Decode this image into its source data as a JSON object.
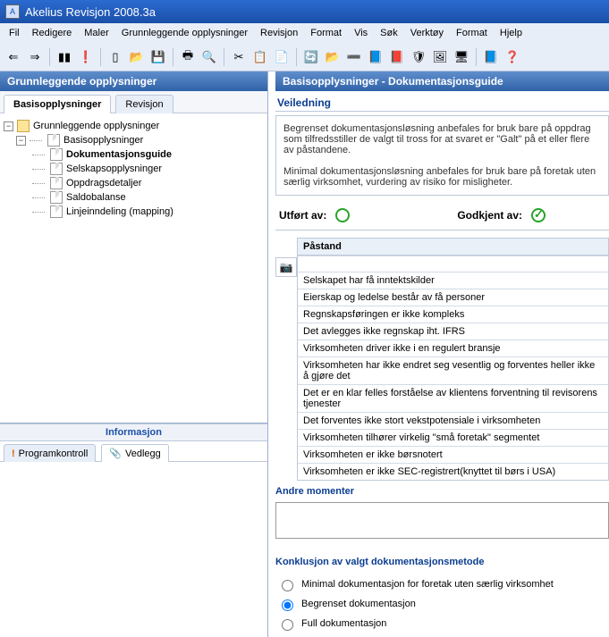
{
  "window": {
    "title": "Akelius Revisjon 2008.3a"
  },
  "menu": [
    "Fil",
    "Redigere",
    "Maler",
    "Grunnleggende opplysninger",
    "Revisjon",
    "Format",
    "Vis",
    "Søk",
    "Verktøy",
    "Format",
    "Hjelp"
  ],
  "toolbar_icons": [
    "⇐",
    "⇒",
    "▮▮",
    "❗",
    "▯",
    "📂",
    "💾",
    "🖶",
    "🔍",
    "✂",
    "📋",
    "📄",
    "🔄",
    "📂",
    "➖",
    "📘",
    "📕",
    "🛡",
    "🖼",
    "🖥",
    "📘",
    "❓"
  ],
  "left": {
    "panel_title": "Grunnleggende opplysninger",
    "tabs": [
      {
        "label": "Basisopplysninger",
        "active": true
      },
      {
        "label": "Revisjon",
        "active": false
      }
    ],
    "tree": {
      "root": "Grunnleggende opplysninger",
      "child": "Basisopplysninger",
      "items": [
        {
          "label": "Dokumentasjonsguide",
          "selected": true
        },
        {
          "label": "Selskapsopplysninger"
        },
        {
          "label": "Oppdragsdetaljer"
        },
        {
          "label": "Saldobalanse"
        },
        {
          "label": "Linjeinndeling (mapping)"
        }
      ]
    },
    "info_title": "Informasjon",
    "info_tabs": [
      {
        "label": "Programkontroll",
        "icon": "!",
        "active": false
      },
      {
        "label": "Vedlegg",
        "icon": "📎",
        "active": true
      }
    ]
  },
  "right": {
    "header": "Basisopplysninger - Dokumentasjonsguide",
    "veiledning_title": "Veiledning",
    "help_p1": "Begrenset dokumentasjonsløsning anbefales for bruk bare på oppdrag som tilfredsstiller de valgt til tross for at svaret er \"Galt\" på et eller flere av påstandene.",
    "help_p2": "Minimal dokumentasjonsløsning anbefales for bruk bare på foretak uten særlig virksomhet, vurdering av risiko for misligheter.",
    "utfort_label": "Utført av:",
    "godkjent_label": "Godkjent av:",
    "pastand_header": "Påstand",
    "pastand_rows": [
      "Selskapet har få inntektskilder",
      "Eierskap og ledelse består av få personer",
      "Regnskapsføringen er ikke kompleks",
      "Det avlegges ikke regnskap iht. IFRS",
      "Virksomheten driver ikke i en regulert bransje",
      "Virksomheten har ikke endret seg vesentlig og forventes heller ikke å gjøre det",
      "Det er en klar felles forståelse av klientens forventning til revisorens tjenester",
      "Det forventes ikke stort vekstpotensiale i virksomheten",
      "Virksomheten tilhører virkelig \"små foretak\" segmentet",
      "Virksomheten er ikke børsnotert",
      "Virksomheten er ikke SEC-registrert(knyttet til børs i USA)"
    ],
    "andre_title": "Andre momenter",
    "konklusjon_title": "Konklusjon av valgt dokumentasjonsmetode",
    "konklusjon_options": [
      {
        "label": "Minimal dokumentasjon for foretak uten særlig virksomhet",
        "value": "min",
        "checked": false
      },
      {
        "label": "Begrenset dokumentasjon",
        "value": "beg",
        "checked": true
      },
      {
        "label": "Full dokumentasjon",
        "value": "full",
        "checked": false
      }
    ]
  }
}
